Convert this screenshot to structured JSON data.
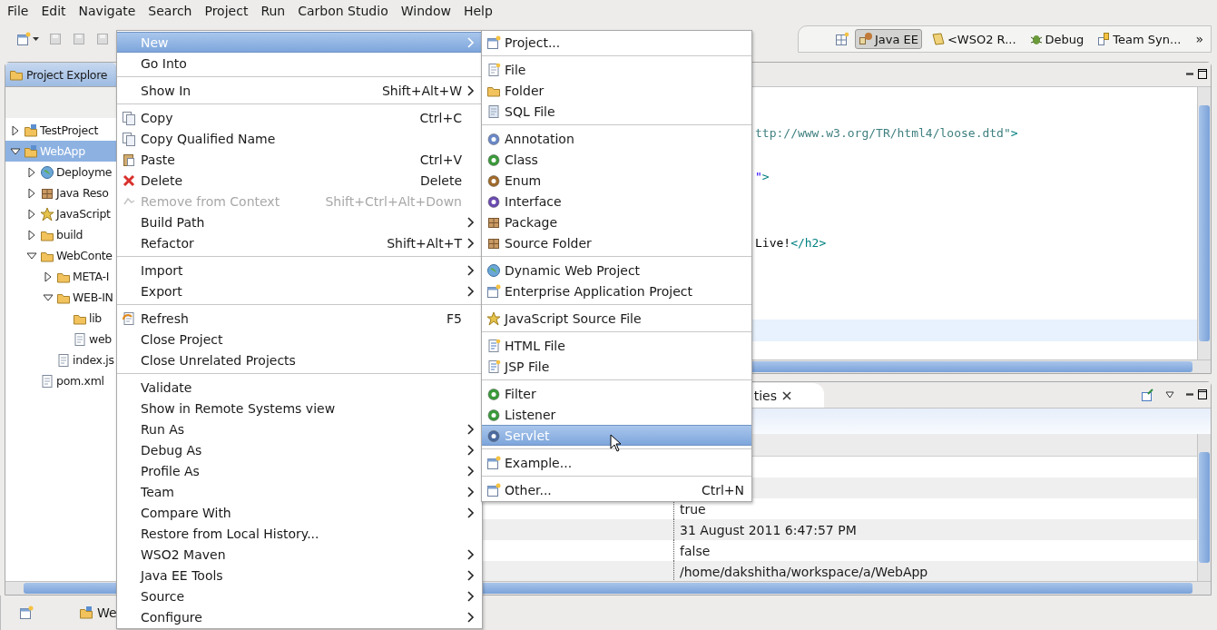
{
  "menu_bar": [
    "File",
    "Edit",
    "Navigate",
    "Search",
    "Project",
    "Run",
    "Carbon Studio",
    "Window",
    "Help"
  ],
  "perspectives": [
    {
      "label": "Java EE",
      "selected": true
    },
    {
      "label": "<WSO2 R...",
      "selected": false
    },
    {
      "label": "Debug",
      "selected": false
    },
    {
      "label": "Team Syn...",
      "selected": false
    }
  ],
  "perspective_overflow": "»",
  "project_explorer": {
    "title": "Project Explore",
    "tree": [
      {
        "label": "TestProject",
        "expanded": false,
        "selected": false
      },
      {
        "label": "WebApp",
        "expanded": true,
        "selected": true,
        "children": [
          {
            "label": "Deployme",
            "expanded": false,
            "selected": false
          },
          {
            "label": "Java Reso",
            "expanded": false,
            "selected": false
          },
          {
            "label": "JavaScript",
            "expanded": false,
            "selected": false
          },
          {
            "label": "build",
            "expanded": false,
            "selected": false
          },
          {
            "label": "WebConte",
            "expanded": true,
            "selected": false,
            "children": [
              {
                "label": "META-I",
                "expanded": false,
                "selected": false
              },
              {
                "label": "WEB-IN",
                "expanded": true,
                "selected": false,
                "children": [
                  {
                    "label": "lib",
                    "selected": false
                  },
                  {
                    "label": "web",
                    "selected": false
                  }
                ]
              },
              {
                "label": "index.js",
                "selected": false
              }
            ]
          },
          {
            "label": "pom.xml",
            "selected": false
          }
        ]
      }
    ]
  },
  "editor": {
    "lines": [
      {
        "segments": [
          {
            "text": "ttp://www.w3.org/TR/html4/loose.dtd\"",
            "kind": "doctype"
          },
          {
            "text": ">",
            "kind": "tag"
          }
        ],
        "current": false
      },
      {
        "segments": [
          {
            "text": "\"",
            "kind": "value"
          },
          {
            "text": ">",
            "kind": "tag"
          }
        ],
        "current": false
      },
      {
        "segments": [
          {
            "text": "Live!",
            "kind": "text"
          },
          {
            "text": "</h2>",
            "kind": "tag"
          }
        ],
        "current": false
      },
      {
        "current": true
      }
    ]
  },
  "properties": {
    "tab": "ties",
    "rows": [
      {
        "value": "true"
      },
      {
        "value": "31 August 2011 6:47:57 PM"
      },
      {
        "value": "false"
      },
      {
        "value": "/home/dakshitha/workspace/a/WebApp"
      }
    ]
  },
  "status_bar": {
    "item": "We"
  },
  "context_menu": {
    "groups": [
      [
        {
          "label": "New",
          "submenu": true,
          "disabled": false,
          "selected": true
        },
        {
          "label": "Go Into",
          "submenu": false,
          "disabled": false,
          "selected": false
        }
      ],
      [
        {
          "label": "Show In",
          "shortcut": "Shift+Alt+W",
          "submenu": true,
          "disabled": false,
          "selected": false
        }
      ],
      [
        {
          "label": "Copy",
          "shortcut": "Ctrl+C",
          "submenu": false,
          "disabled": false,
          "selected": false
        },
        {
          "label": "Copy Qualified Name",
          "submenu": false,
          "disabled": false,
          "selected": false
        },
        {
          "label": "Paste",
          "shortcut": "Ctrl+V",
          "submenu": false,
          "disabled": false,
          "selected": false
        },
        {
          "label": "Delete",
          "shortcut": "Delete",
          "submenu": false,
          "disabled": false,
          "selected": false
        },
        {
          "label": "Remove from Context",
          "shortcut": "Shift+Ctrl+Alt+Down",
          "submenu": false,
          "disabled": true,
          "selected": false
        },
        {
          "label": "Build Path",
          "submenu": true,
          "disabled": false,
          "selected": false
        },
        {
          "label": "Refactor",
          "shortcut": "Shift+Alt+T",
          "submenu": true,
          "disabled": false,
          "selected": false
        }
      ],
      [
        {
          "label": "Import",
          "submenu": true,
          "disabled": false,
          "selected": false
        },
        {
          "label": "Export",
          "submenu": true,
          "disabled": false,
          "selected": false
        }
      ],
      [
        {
          "label": "Refresh",
          "shortcut": "F5",
          "submenu": false,
          "disabled": false,
          "selected": false
        },
        {
          "label": "Close Project",
          "submenu": false,
          "disabled": false,
          "selected": false
        },
        {
          "label": "Close Unrelated Projects",
          "submenu": false,
          "disabled": false,
          "selected": false
        }
      ],
      [
        {
          "label": "Validate",
          "submenu": false,
          "disabled": false,
          "selected": false
        },
        {
          "label": "Show in Remote Systems view",
          "submenu": false,
          "disabled": false,
          "selected": false
        },
        {
          "label": "Run As",
          "submenu": true,
          "disabled": false,
          "selected": false
        },
        {
          "label": "Debug As",
          "submenu": true,
          "disabled": false,
          "selected": false
        },
        {
          "label": "Profile As",
          "submenu": true,
          "disabled": false,
          "selected": false
        },
        {
          "label": "Team",
          "submenu": true,
          "disabled": false,
          "selected": false
        },
        {
          "label": "Compare With",
          "submenu": true,
          "disabled": false,
          "selected": false
        },
        {
          "label": "Restore from Local History...",
          "submenu": false,
          "disabled": false,
          "selected": false
        },
        {
          "label": "WSO2 Maven",
          "submenu": true,
          "disabled": false,
          "selected": false
        },
        {
          "label": "Java EE Tools",
          "submenu": true,
          "disabled": false,
          "selected": false
        },
        {
          "label": "Source",
          "submenu": true,
          "disabled": false,
          "selected": false
        },
        {
          "label": "Configure",
          "submenu": true,
          "disabled": false,
          "selected": false
        }
      ]
    ]
  },
  "new_submenu": {
    "groups": [
      [
        {
          "label": "Project...",
          "selected": false
        }
      ],
      [
        {
          "label": "File",
          "selected": false
        },
        {
          "label": "Folder",
          "selected": false
        },
        {
          "label": "SQL File",
          "selected": false
        }
      ],
      [
        {
          "label": "Annotation",
          "selected": false
        },
        {
          "label": "Class",
          "selected": false
        },
        {
          "label": "Enum",
          "selected": false
        },
        {
          "label": "Interface",
          "selected": false
        },
        {
          "label": "Package",
          "selected": false
        },
        {
          "label": "Source Folder",
          "selected": false
        }
      ],
      [
        {
          "label": "Dynamic Web Project",
          "selected": false
        },
        {
          "label": "Enterprise Application Project",
          "selected": false
        }
      ],
      [
        {
          "label": "JavaScript Source File",
          "selected": false
        }
      ],
      [
        {
          "label": "HTML File",
          "selected": false
        },
        {
          "label": "JSP File",
          "selected": false
        }
      ],
      [
        {
          "label": "Filter",
          "selected": false
        },
        {
          "label": "Listener",
          "selected": false
        },
        {
          "label": "Servlet",
          "selected": true
        }
      ],
      [
        {
          "label": "Example...",
          "selected": false
        }
      ],
      [
        {
          "label": "Other...",
          "shortcut": "Ctrl+N",
          "selected": false
        }
      ]
    ]
  }
}
